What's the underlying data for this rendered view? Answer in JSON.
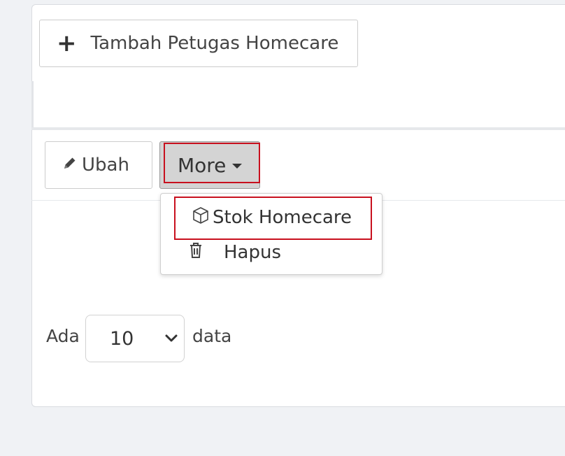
{
  "toolbar": {
    "add_label": "Tambah Petugas Homecare",
    "edit_label": "Ubah",
    "more_label": "More"
  },
  "dropdown_menu": {
    "items": [
      {
        "label": "Stok Homecare",
        "icon": "cube-icon"
      },
      {
        "label": "Hapus",
        "icon": "trash-icon"
      }
    ]
  },
  "page_size": {
    "prefix": "Ada",
    "value": "10",
    "suffix": "data"
  },
  "colors": {
    "highlight": "#c8101e",
    "more_button_bg": "#d4d4d4"
  }
}
